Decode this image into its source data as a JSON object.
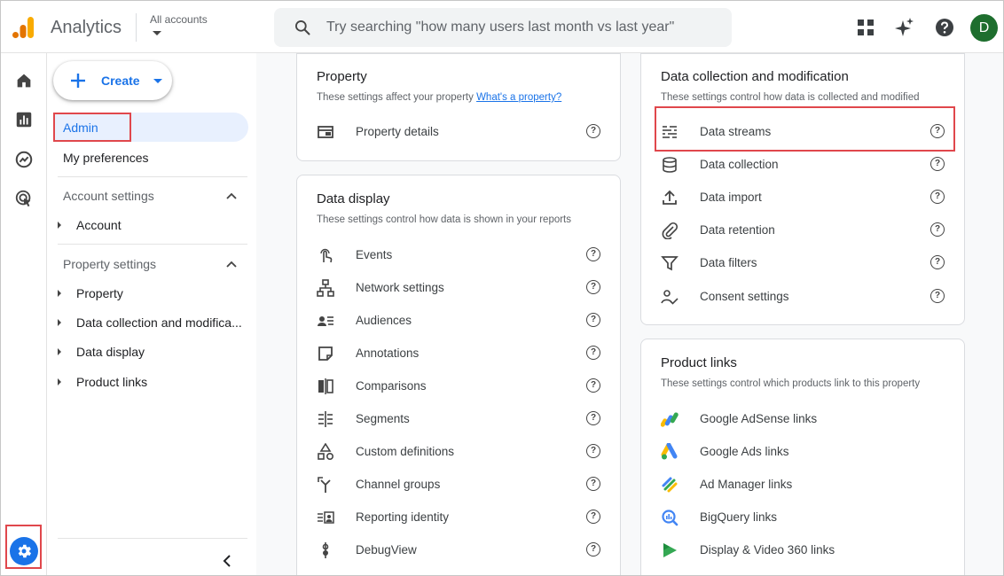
{
  "header": {
    "app_title": "Analytics",
    "accounts_label": "All accounts",
    "search_placeholder": "Try searching \"how many users last month vs last year\"",
    "avatar_initial": "D"
  },
  "nav": {
    "create_label": "Create",
    "admin_label": "Admin",
    "preferences_label": "My preferences",
    "account_settings_label": "Account settings",
    "account_items": [
      "Account"
    ],
    "property_settings_label": "Property settings",
    "property_items": [
      "Property",
      "Data collection and modifica...",
      "Data display",
      "Product links"
    ]
  },
  "cards": {
    "property": {
      "title": "Property",
      "subtitle": "These settings affect your property",
      "link": "What's a property?",
      "rows": [
        "Property details"
      ]
    },
    "data_display": {
      "title": "Data display",
      "subtitle": "These settings control how data is shown in your reports",
      "rows": [
        "Events",
        "Network settings",
        "Audiences",
        "Annotations",
        "Comparisons",
        "Segments",
        "Custom definitions",
        "Channel groups",
        "Reporting identity",
        "DebugView"
      ]
    },
    "data_collection": {
      "title": "Data collection and modification",
      "subtitle": "These settings control how data is collected and modified",
      "rows": [
        "Data streams",
        "Data collection",
        "Data import",
        "Data retention",
        "Data filters",
        "Consent settings"
      ]
    },
    "product_links": {
      "title": "Product links",
      "subtitle": "These settings control which products link to this property",
      "rows": [
        "Google AdSense links",
        "Google Ads links",
        "Ad Manager links",
        "BigQuery links",
        "Display & Video 360 links"
      ]
    }
  },
  "help_glyph": "?",
  "colors": {
    "accent": "#1a73e8",
    "highlight_box": "#e0474c",
    "avatar": "#1e6e2e",
    "logo_orange": "#f9ab00",
    "logo_dark_orange": "#e37400"
  }
}
